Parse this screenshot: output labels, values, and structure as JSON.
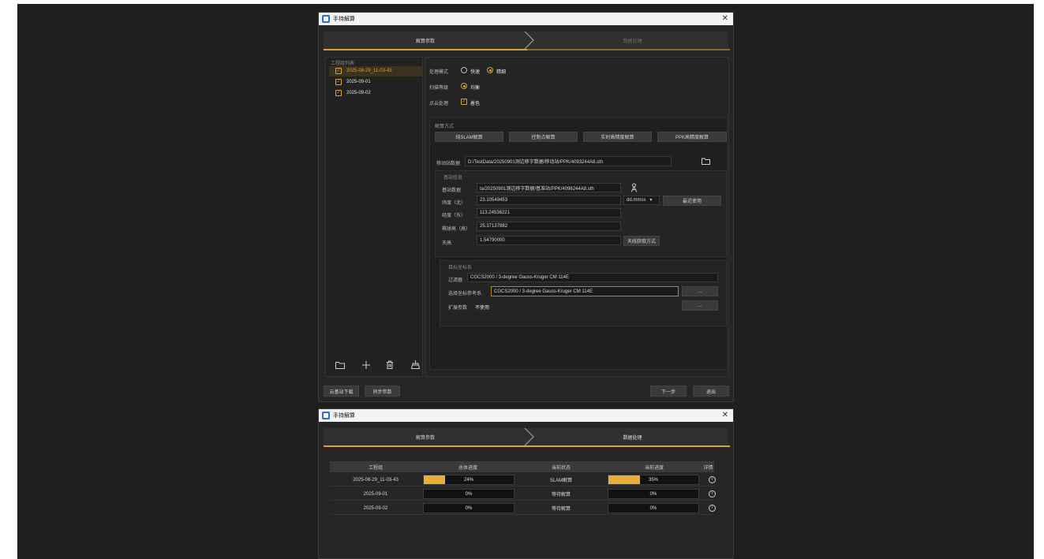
{
  "window1": {
    "title": "手持解算",
    "steps": [
      "解算参数",
      "数据处理"
    ],
    "project_list": {
      "title": "工程组列表",
      "items": [
        {
          "name": "2025-08-29_11-03-43",
          "checked": true,
          "selected": true
        },
        {
          "name": "2025-09-01",
          "checked": true,
          "selected": false
        },
        {
          "name": "2025-09-02",
          "checked": true,
          "selected": false
        }
      ],
      "toolbar_icons": [
        "folder-icon",
        "add-icon",
        "trash-icon",
        "clean-icon"
      ]
    },
    "options": {
      "process_mode_label": "处理模式",
      "fast_label": "快速",
      "fine_label": "精细",
      "scan_mode_label": "扫描等级",
      "scan_value": "均衡",
      "pointcloud_label": "点云处理",
      "color_label": "着色"
    },
    "solve_method": {
      "title": "解算方式",
      "buttons": [
        "纯SLAM解算",
        "控制点解算",
        "实时高精度解算",
        "PPK高精度解算"
      ]
    },
    "mobile_data": {
      "label": "移动站数据",
      "value": "D:/TestData/20250901测边移字数据/移动站/PPK/4093244A8.sth"
    },
    "base_info": {
      "title": "基站信息",
      "base_data_label": "基站数据",
      "base_data_value": "ta/20250901测边移字数据/基准站/PPK/4096244A8.sth",
      "lat_label": "纬度（北）",
      "lat_value": "23.10549453",
      "lat_format": "dd.mmss",
      "recent_button": "最近使用",
      "lon_label": "经度（东）",
      "lon_value": "113.24536221",
      "height_label": "椭球高（高）",
      "height_value": "25.37137882",
      "antenna_label": "天高",
      "antenna_value": "1.54790000",
      "antenna_button": "天线获取方式"
    },
    "target_crs": {
      "title": "目标坐标系",
      "source_label": "过滤器",
      "source_value": "CGCS2000 / 3-degree Gauss-Kruger CM 114E",
      "select_label": "选择坐标参考系",
      "select_value": "CGCS2000 / 3-degree Gauss-Kruger CM 114E",
      "select_button": "...",
      "ext_label": "扩展参数",
      "ext_value": "不使用",
      "ext_button": "..."
    },
    "footer": {
      "cloud_download": "云基站下载",
      "sync_params": "同步参数",
      "next": "下一步",
      "exit": "退出"
    }
  },
  "window2": {
    "title": "手持解算",
    "steps": [
      "解算参数",
      "数据处理"
    ],
    "table": {
      "headers": [
        "工程组",
        "总体进度",
        "当前状态",
        "当前进度",
        "详情"
      ],
      "rows": [
        {
          "name": "2025-08-29_11-03-43",
          "total": "24%",
          "total_frac": 0.24,
          "status": "SLAM解算",
          "current": "35%",
          "current_frac": 0.35
        },
        {
          "name": "2025-09-01",
          "total": "0%",
          "total_frac": 0,
          "status": "等待解算",
          "current": "0%",
          "current_frac": 0
        },
        {
          "name": "2025-09-02",
          "total": "0%",
          "total_frac": 0,
          "status": "等待解算",
          "current": "0%",
          "current_frac": 0
        }
      ]
    }
  },
  "colors": {
    "accent": "#d8a23a",
    "progress_fill": "#e8ae3a",
    "panel": "#262626",
    "backdrop": "#1f1f1f"
  }
}
